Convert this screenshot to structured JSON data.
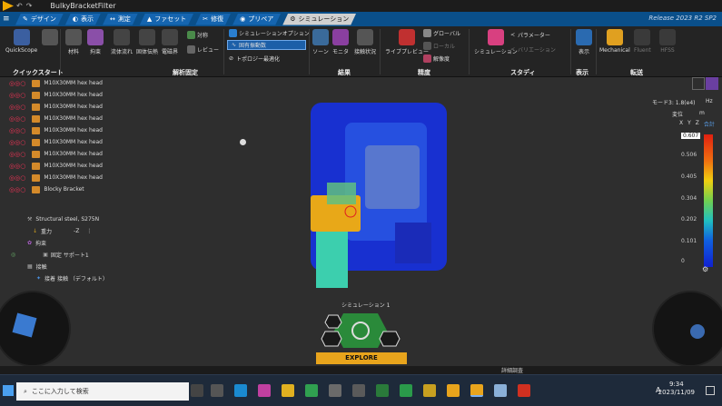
{
  "titlebar": {
    "title": "BulkyBracketFilter"
  },
  "tabs": [
    {
      "label": "デザイン"
    },
    {
      "label": "表示"
    },
    {
      "label": "測定"
    },
    {
      "label": "ファセット"
    },
    {
      "label": "修復"
    },
    {
      "label": "プリペア"
    },
    {
      "label": "シミュレーション"
    }
  ],
  "release": "Release 2023 R2 SP2",
  "ribbon": {
    "quickstart": {
      "label": "QuickScope",
      "group": "クイックスタート"
    },
    "analysis": {
      "items": [
        "材料",
        "拘束",
        "流体流れ",
        "固体伝熱",
        "電磁界"
      ],
      "extra": [
        "対称",
        "レビュー"
      ],
      "group": "解析固定"
    },
    "dropdowns": [
      "シミュレーションオプション",
      "固有振動数",
      "トポロジー最適化"
    ],
    "results": {
      "items": [
        "ソーン",
        "モニタ",
        "接触状況"
      ],
      "group": "結果"
    },
    "accuracy": {
      "items": [
        "ライブプレビュー",
        "グローバル",
        "ローカル",
        "解像度"
      ],
      "group": "精度"
    },
    "study": {
      "items": [
        "シミュレーション",
        "パラメーター",
        "バリエーション"
      ],
      "group": "スタディ"
    },
    "display": {
      "items": [
        "表示"
      ],
      "group": "表示"
    },
    "transfer": {
      "items": [
        "Mechanical",
        "Fluent",
        "HFSS"
      ],
      "group": "転送"
    }
  },
  "tree": {
    "parts": [
      "M10X30MM hex head",
      "M10X30MM hex head",
      "M10X30MM hex head",
      "M10X30MM hex head",
      "M10X30MM hex head",
      "M10X30MM hex head",
      "M10X30MM hex head",
      "M10X30MM hex head",
      "M10X30MM hex head",
      "Blocky Bracket"
    ],
    "material": "Structural steel, S275N",
    "gravity": "重力",
    "gravity_axis": "-Z",
    "constraints": "拘束",
    "fixed": "固定 サポート1",
    "contacts": "接触",
    "contact_default": "接着 接触 （デフォルト）"
  },
  "legend": {
    "mode": "モード3: 1.8(e4)",
    "unit_freq": "Hz",
    "unit_label": "変位",
    "unit_m": "m",
    "axes": [
      "X",
      "Y",
      "Z",
      "合計"
    ],
    "values": [
      "0.607",
      "0.506",
      "0.405",
      "0.304",
      "0.202",
      "0.101",
      "0"
    ]
  },
  "explore": {
    "sim_label": "シミュレーション 1",
    "button": "EXPLORE"
  },
  "status": {
    "mode": "詳細調査"
  },
  "taskbar": {
    "search_placeholder": "ここに入力して検索",
    "time": "9:34",
    "date": "2023/11/09",
    "ime": "A"
  },
  "colors": {
    "accent": "#f2a900",
    "tab_blue": "#1565b0",
    "hex_green": "#2a8a3a"
  }
}
